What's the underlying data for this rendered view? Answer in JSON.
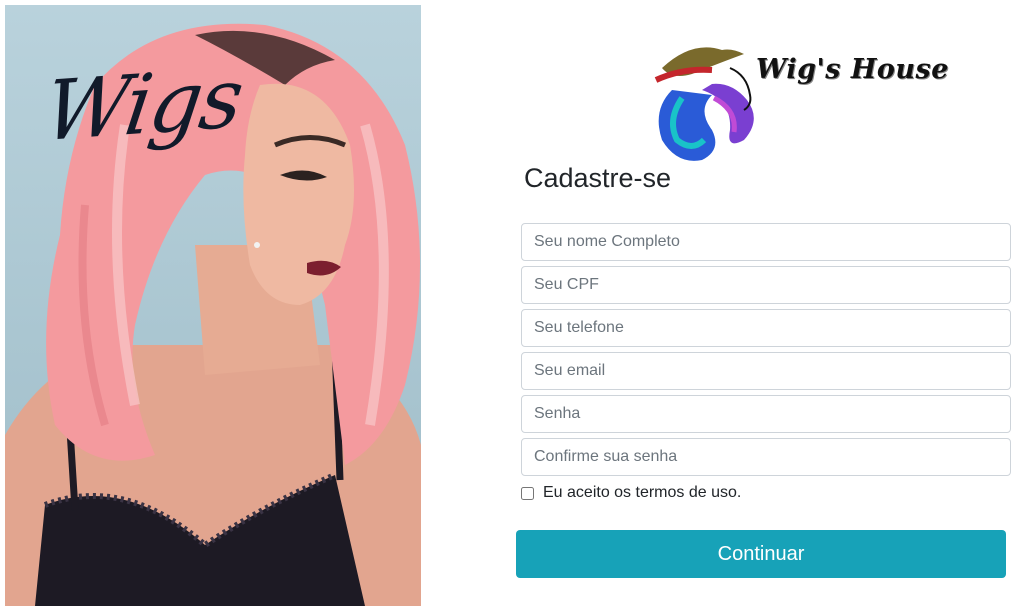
{
  "hero": {
    "script_text": "Wigs"
  },
  "brand": {
    "logo_text": "Wig's House"
  },
  "form": {
    "title": "Cadastre-se",
    "fields": [
      {
        "placeholder": "Seu nome Completo",
        "value": ""
      },
      {
        "placeholder": "Seu CPF",
        "value": ""
      },
      {
        "placeholder": "Seu telefone",
        "value": ""
      },
      {
        "placeholder": "Seu email",
        "value": ""
      },
      {
        "placeholder": "Senha",
        "value": ""
      },
      {
        "placeholder": "Confirme sua senha",
        "value": ""
      }
    ],
    "terms_label": "Eu aceito os termos de uso.",
    "terms_checked": false,
    "submit_label": "Continuar"
  },
  "colors": {
    "accent": "#17a2b8",
    "hair_pink": "#f49a9e",
    "background": "#ffffff"
  }
}
